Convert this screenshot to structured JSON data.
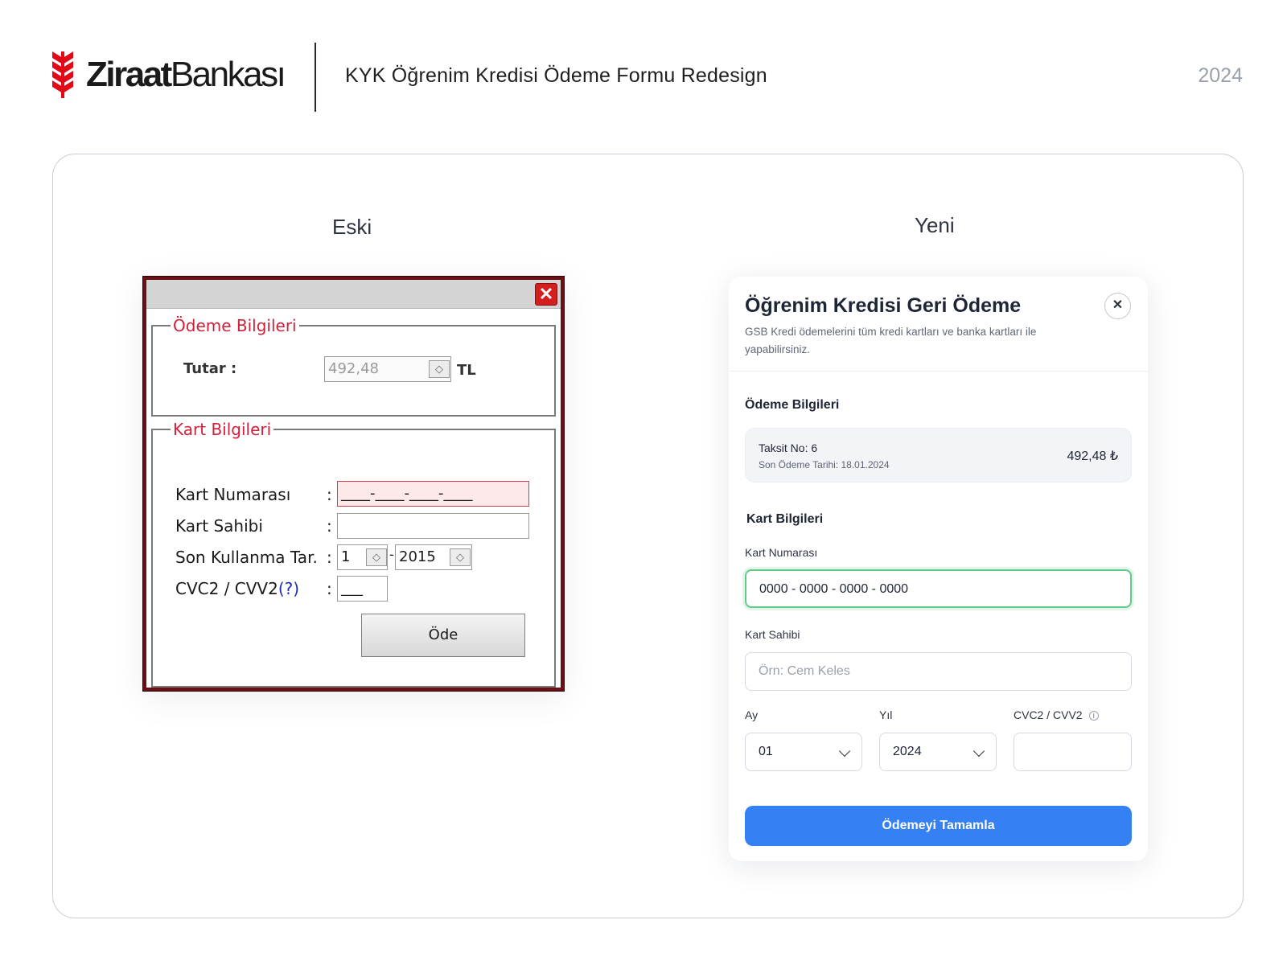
{
  "header": {
    "brand_bold": "Ziraat",
    "brand_light": "Bankası",
    "title": "KYK Öğrenim Kredisi Ödeme Formu Redesign",
    "year": "2024"
  },
  "sections": {
    "old": "Eski",
    "new": "Yeni"
  },
  "old_form": {
    "close": "✕",
    "payment_group": "Ödeme Bilgileri",
    "amount_label": "Tutar :",
    "amount_value": "492,48",
    "currency": "TL",
    "card_group": "Kart Bilgileri",
    "card_number_label": "Kart Numarası",
    "card_number_value": "____-____-____-____",
    "card_holder_label": "Kart Sahibi",
    "expiry_label": "Son Kullanma Tar.",
    "expiry_month": "1",
    "expiry_sep": "-",
    "expiry_year": "2015",
    "cvc_label": "CVC2 / CVV2",
    "cvc_help": "(?)",
    "cvc_value": "___",
    "colon": ":",
    "submit": "Öde"
  },
  "new_form": {
    "title": "Öğrenim Kredisi Geri Ödeme",
    "subtitle": "GSB Kredi ödemelerini tüm kredi kartları ve banka kartları ile yapabilirsiniz.",
    "close": "✕",
    "payment_section": "Ödeme Bilgileri",
    "installment_no": "Taksit No: 6",
    "due_date": "Son Ödeme Tarihi: 18.01.2024",
    "amount": "492,48 ₺",
    "card_section": "Kart Bilgileri",
    "card_number_label": "Kart Numarası",
    "card_number_value": "0000 - 0000 - 0000 - 0000",
    "card_holder_label": "Kart Sahibi",
    "card_holder_placeholder": "Örn: Cem Keles",
    "month_label": "Ay",
    "month_value": "01",
    "year_label": "Yıl",
    "year_value": "2024",
    "cvc_label": "CVC2 / CVV2",
    "submit": "Ödemeyi Tamamla"
  },
  "colors": {
    "brand_red": "#e30a17",
    "old_border": "#6b0f16",
    "legend_red": "#d0213a",
    "focus_green": "#62c987",
    "primary_blue": "#3580f3"
  }
}
